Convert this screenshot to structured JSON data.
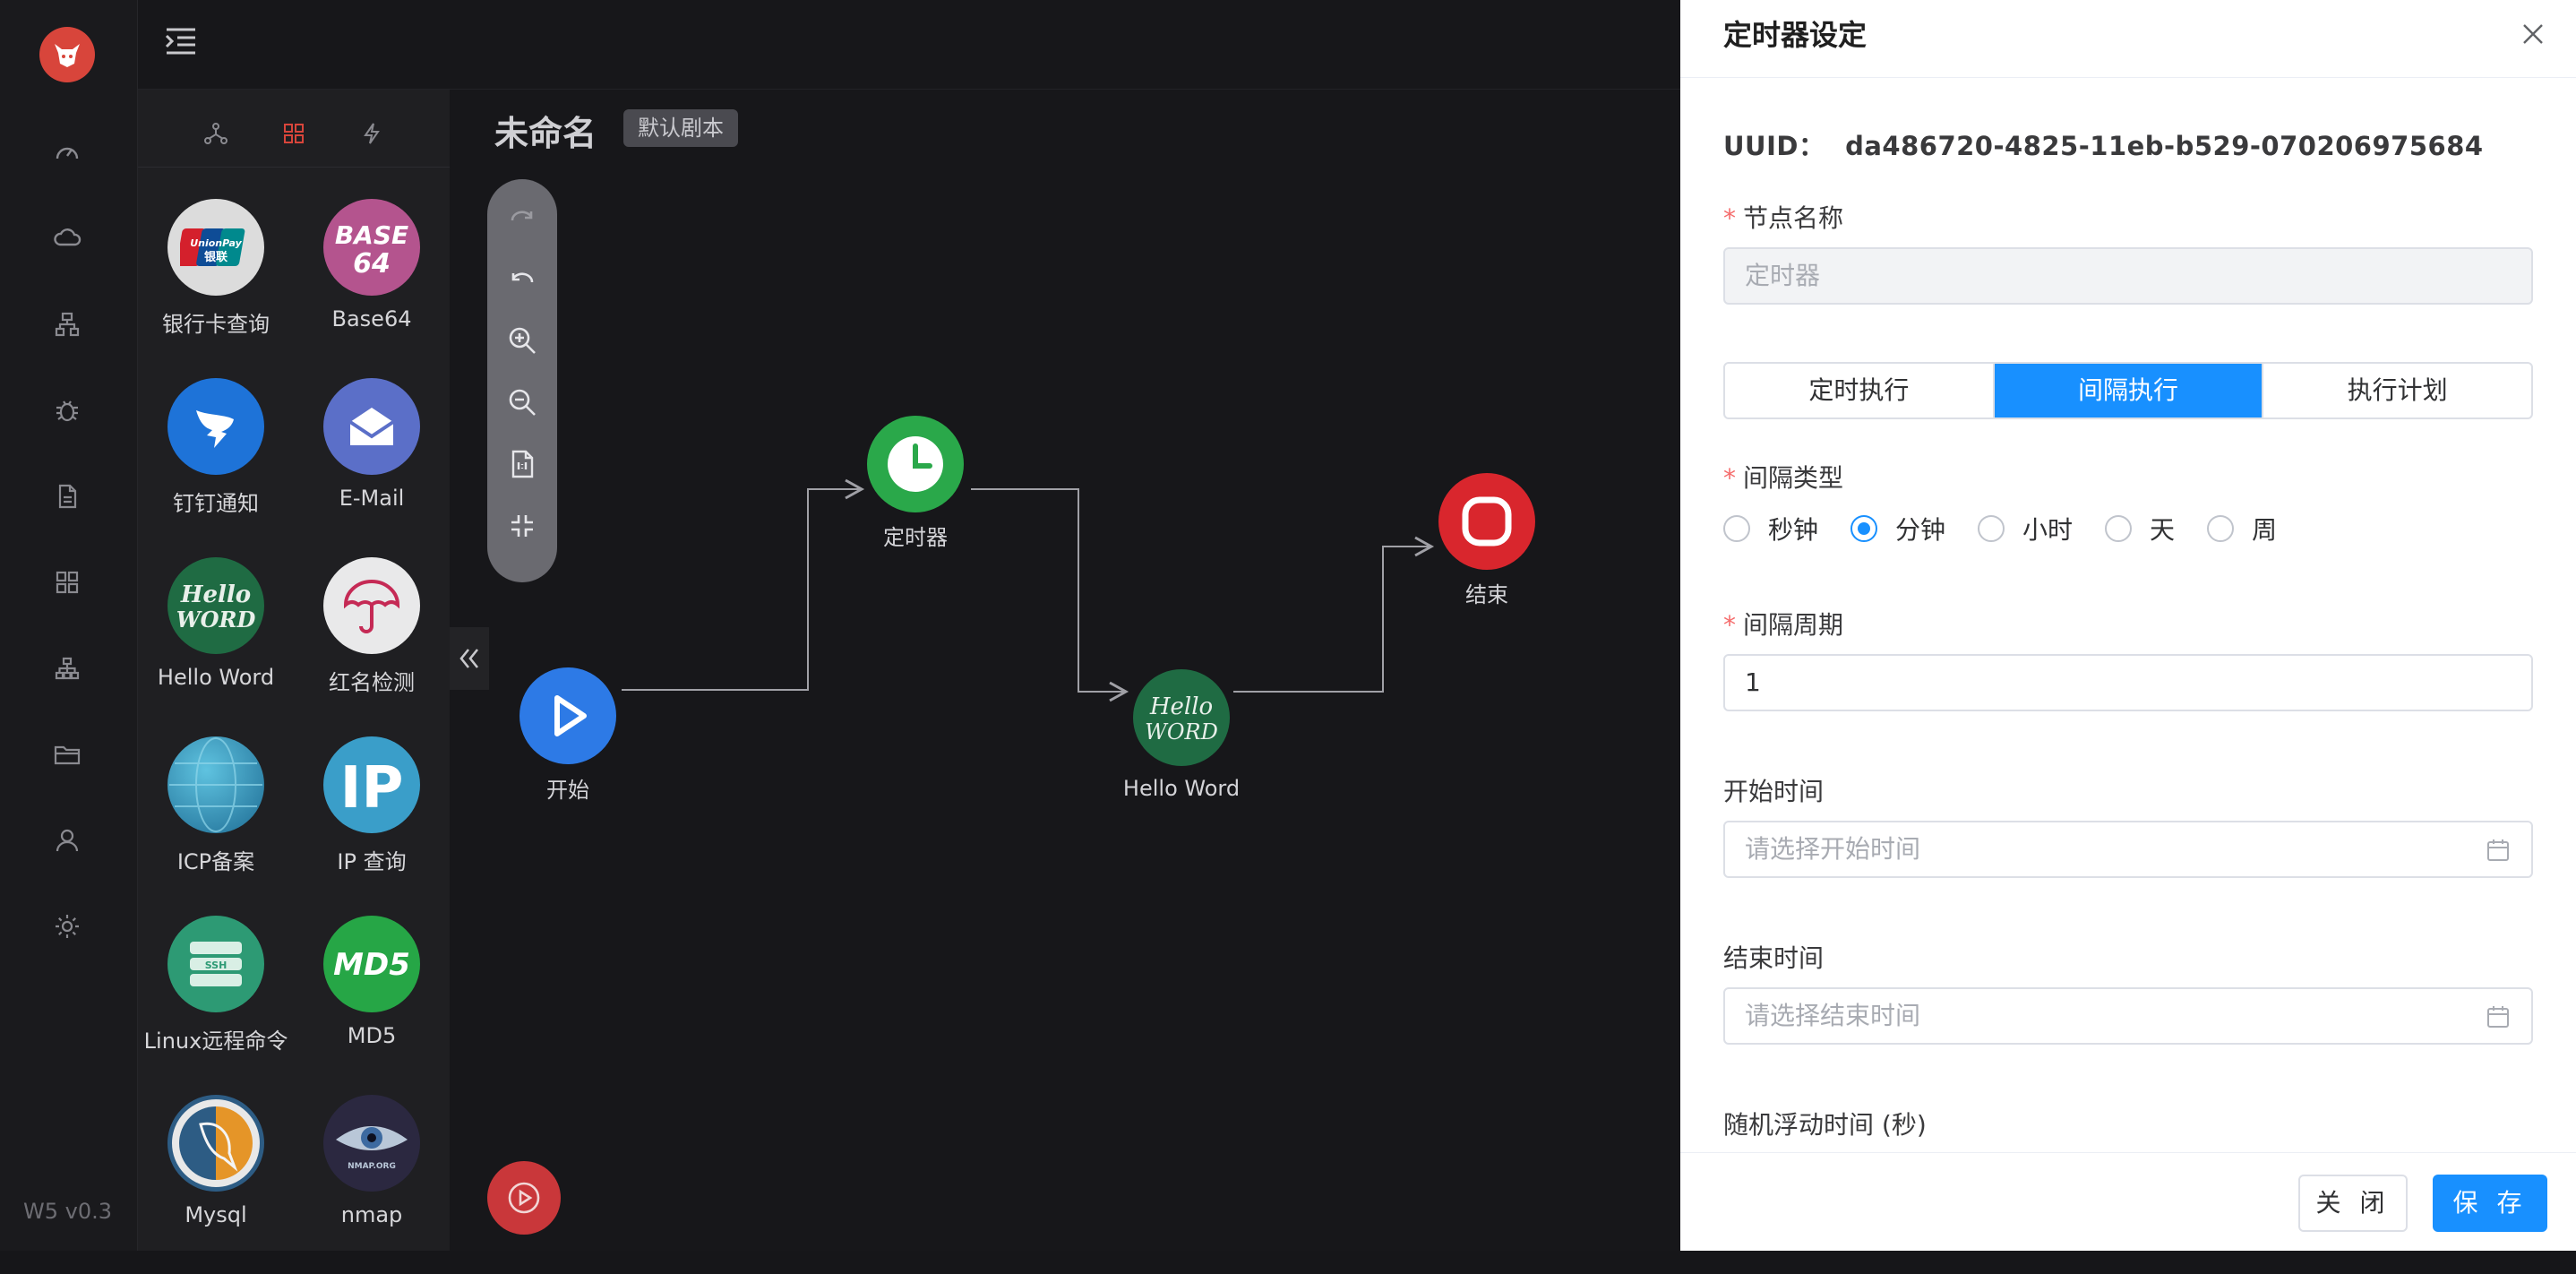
{
  "app": {
    "version": "W5 v0.3"
  },
  "nav": {
    "icons": [
      "dashboard-icon",
      "cloud-icon",
      "sitemap-icon",
      "bug-icon",
      "document-icon",
      "apps-icon",
      "network-icon",
      "folder-icon",
      "user-icon",
      "gear-icon"
    ]
  },
  "palette": {
    "tabs": [
      "tree-icon",
      "grid-icon",
      "bolt-icon"
    ],
    "items": [
      {
        "label": "银行卡查询",
        "logo_text": "UnionPay 银联",
        "color": "#dcdcdc"
      },
      {
        "label": "Base64",
        "logo_text": "BASE 64",
        "color": "#b4548e"
      },
      {
        "label": "钉钉通知",
        "logo_text": "",
        "color": "#1e73d8"
      },
      {
        "label": "E-Mail",
        "logo_text": "",
        "color": "#5b6fc8"
      },
      {
        "label": "Hello Word",
        "logo_text": "Hello WORD",
        "color": "#1f6b43"
      },
      {
        "label": "红名检测",
        "logo_text": "",
        "color": "#e9e9ea"
      },
      {
        "label": "ICP备案",
        "logo_text": "",
        "color": "#2a8fb5"
      },
      {
        "label": "IP 查询",
        "logo_text": "IP",
        "color": "#3a9ec9"
      },
      {
        "label": "Linux远程命令",
        "logo_text": "SSH",
        "color": "#2d9a74"
      },
      {
        "label": "MD5",
        "logo_text": "MD5",
        "color": "#26a646"
      },
      {
        "label": "Mysql",
        "logo_text": "",
        "color": "#2d5c84"
      },
      {
        "label": "nmap",
        "logo_text": "NMAP.ORG",
        "color": "#2b2840"
      }
    ]
  },
  "canvas": {
    "title": "未命名",
    "badge": "默认剧本",
    "nodes": [
      {
        "id": "start",
        "label": "开始",
        "color": "#2d7ae6"
      },
      {
        "id": "timer",
        "label": "定时器",
        "color": "#2aa84a"
      },
      {
        "id": "hello",
        "label": "Hello Word",
        "logo_text": "Hello WORD",
        "color": "#1f6b43"
      },
      {
        "id": "end",
        "label": "结束",
        "color": "#d9262d"
      }
    ]
  },
  "drawer": {
    "title": "定时器设定",
    "uuid_label": "UUID：",
    "uuid_value": "da486720-4825-11eb-b529-070206975684",
    "node_name_label": "节点名称",
    "node_name_value": "定时器",
    "segments": [
      "定时执行",
      "间隔执行",
      "执行计划"
    ],
    "active_segment": "间隔执行",
    "interval_type_label": "间隔类型",
    "interval_types": [
      "秒钟",
      "分钟",
      "小时",
      "天",
      "周"
    ],
    "interval_type_selected": "分钟",
    "interval_period_label": "间隔周期",
    "interval_period_value": "1",
    "start_time_label": "开始时间",
    "start_time_placeholder": "请选择开始时间",
    "end_time_label": "结束时间",
    "end_time_placeholder": "请选择结束时间",
    "random_label": "随机浮动时间 (秒)",
    "cancel_label": "关 闭",
    "save_label": "保 存"
  }
}
